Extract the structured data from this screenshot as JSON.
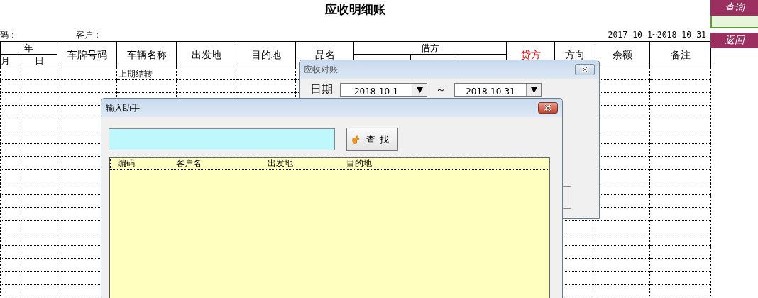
{
  "sheet": {
    "title": "应收明细账",
    "code_label": "码：",
    "customer_label": "客户：",
    "date_range": "2017-10-1~2018-10-31",
    "year_header": "年",
    "month_header": "月",
    "day_header": "日",
    "columns": [
      {
        "kind": "single",
        "label": "车牌号码"
      },
      {
        "kind": "single",
        "label": "车辆名称"
      },
      {
        "kind": "single",
        "label": "出发地"
      },
      {
        "kind": "single",
        "label": "目的地"
      },
      {
        "kind": "single",
        "label": "品名"
      },
      {
        "kind": "group",
        "label": "借方"
      },
      {
        "kind": "single",
        "label": "贷方",
        "color": "#ff0000"
      },
      {
        "kind": "single",
        "label": "方向"
      },
      {
        "kind": "single",
        "label": "余额"
      },
      {
        "kind": "single",
        "label": "备注"
      }
    ],
    "rows": [
      {
        "vehicle_name": "上期结转"
      }
    ]
  },
  "side_buttons": [
    {
      "label": "查询"
    },
    {
      "label": "返回"
    }
  ],
  "dialogs": [
    {
      "kind": "reconcile",
      "title": "应收对账",
      "date_label": "日期",
      "date_from": "2018-10-1",
      "separator": "～",
      "date_to": "2018-10-31"
    },
    {
      "kind": "input_helper",
      "title": "输入助手",
      "search_button": "查找",
      "list_columns": [
        "编码",
        "客户名",
        "出发地",
        "目的地"
      ]
    }
  ]
}
